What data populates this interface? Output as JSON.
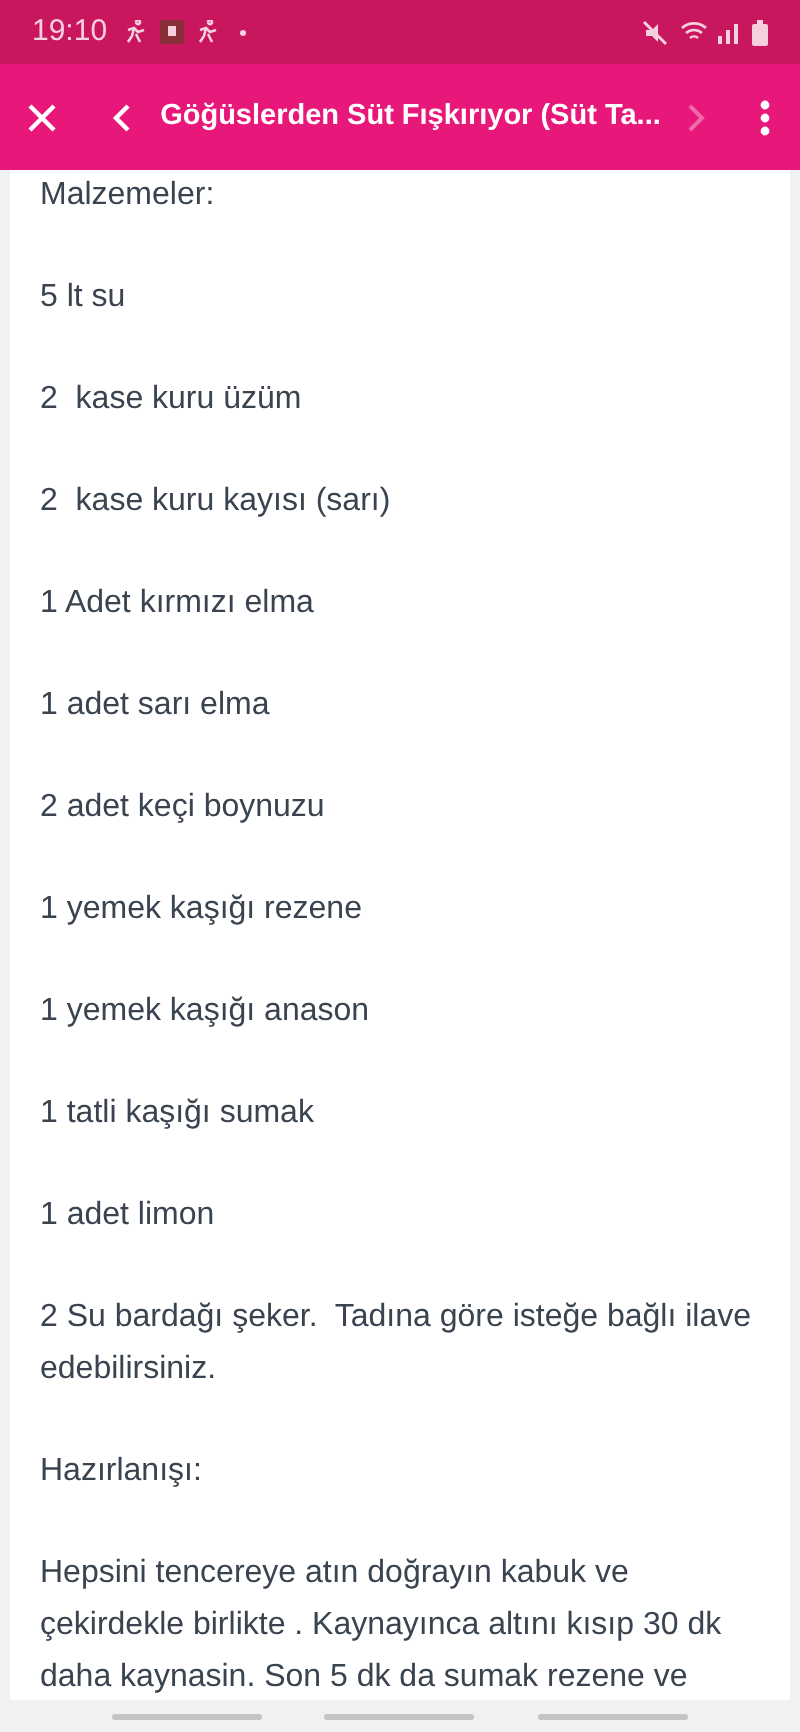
{
  "status_bar": {
    "time": "19:10"
  },
  "toolbar": {
    "title": "Göğüslerden Süt Fışkırıyor (Süt Ta...",
    "next_disabled": true
  },
  "content": {
    "heading": "Malzemeler:",
    "ingredients": [
      "5 lt su",
      "2  kase kuru üzüm",
      "2  kase kuru kayısı (sarı)",
      "1 Adet kırmızı elma",
      "1 adet sarı elma",
      "2 adet keçi boynuzu",
      "1 yemek kaşığı rezene",
      "1 yemek kaşığı anason",
      "1 tatli kaşığı sumak",
      "1 adet limon",
      "2 Su bardağı şeker.  Tadına göre isteğe bağlı ilave edebilirsiniz."
    ],
    "method_heading": "Hazırlanışı:",
    "method": "Hepsini tencereye atın doğrayın kabuk ve çekirdekle birlikte . Kaynayınca altını kısıp 30 dk daha kaynasin. Son 5 dk da sumak rezene ve"
  }
}
